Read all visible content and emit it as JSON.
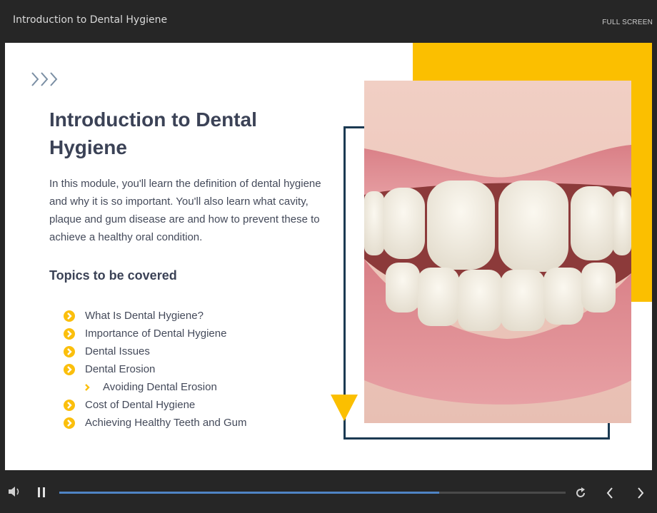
{
  "window": {
    "title": "Introduction to Dental Hygiene",
    "fullscreen_label": "FULL SCREEN"
  },
  "slide": {
    "heading_line1": "Introduction to Dental",
    "heading_line2": "Hygiene",
    "intro": "In this module, you'll learn the definition of dental hygiene and why it is so important. You'll also learn what cavity, plaque and gum disease are and how to prevent these to achieve a healthy oral condition.",
    "topics_heading": "Topics to be covered",
    "topics": [
      {
        "label": "What Is Dental Hygiene?",
        "level": 1
      },
      {
        "label": "Importance of Dental Hygiene",
        "level": 1
      },
      {
        "label": "Dental Issues",
        "level": 1
      },
      {
        "label": "Dental Erosion",
        "level": 1
      },
      {
        "label": "Avoiding Dental Erosion",
        "level": 2
      },
      {
        "label": "Cost of Dental Hygiene",
        "level": 1
      },
      {
        "label": "Achieving Healthy Teeth and Gum",
        "level": 1
      }
    ],
    "photo": {
      "icon": "smiling-teeth-photo"
    }
  },
  "player": {
    "progress": 0.75,
    "icons": [
      "volume-icon",
      "pause-icon",
      "replay-icon",
      "previous-icon",
      "next-icon"
    ]
  },
  "colors": {
    "accent": "#fbbf00",
    "frame": "#1b3a52",
    "text": "#3b4256",
    "progress": "#4f84c4",
    "bar": "#262626"
  }
}
